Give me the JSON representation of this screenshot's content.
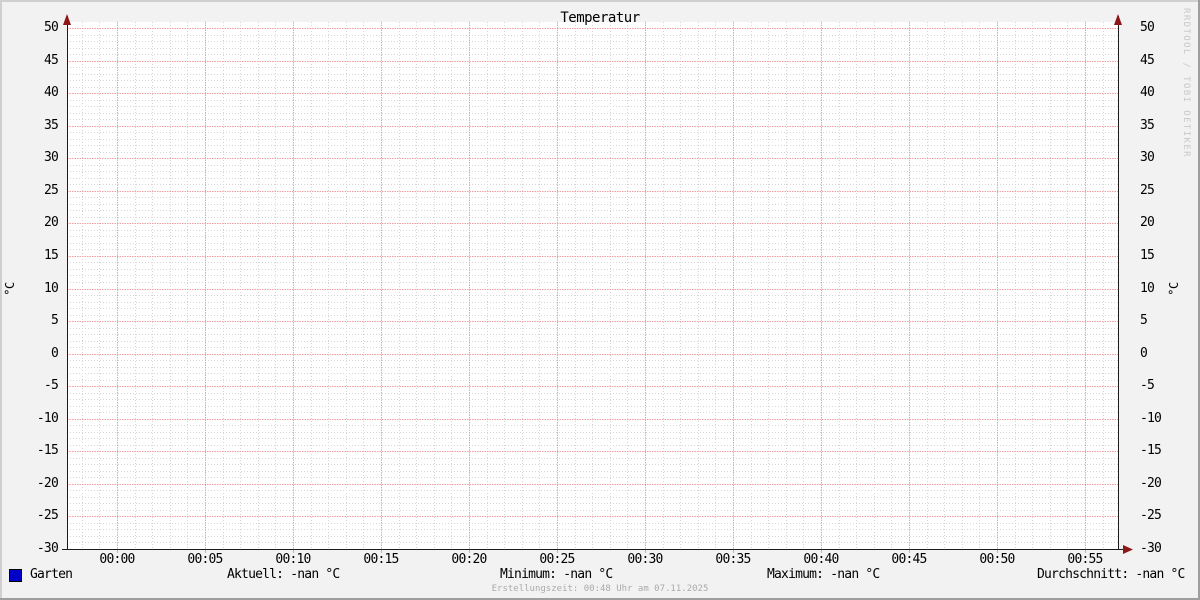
{
  "title": "Temperatur",
  "watermark": "RRDTOOL / TOBI OETIKER",
  "axis": {
    "y_label_left": "°C",
    "y_label_right": "°C",
    "y_ticks": [
      50,
      45,
      40,
      35,
      30,
      25,
      20,
      15,
      10,
      5,
      0,
      -5,
      -10,
      -15,
      -20,
      -25,
      -30
    ],
    "x_ticks": [
      "00:00",
      "00:05",
      "00:10",
      "00:15",
      "00:20",
      "00:25",
      "00:30",
      "00:35",
      "00:40",
      "00:45",
      "00:50",
      "00:55"
    ]
  },
  "legend": {
    "series_label": "Garten",
    "series_color": "#0000c8",
    "stats": [
      "Aktuell: -nan °C",
      "Minimum: -nan °C",
      "Maximum: -nan °C",
      "Durchschnitt: -nan °C"
    ],
    "footer": "Erstellungszeit: 00:48 Uhr am 07.11.2025"
  },
  "colors": {
    "back": "#f2f2f2",
    "canvas": "#ffffff",
    "major-grid": "#f0a0a0",
    "minor-grid": "#d6d6d6",
    "axis": "#1c1c1c",
    "arrow": "#8f1616",
    "faint": "#aaaaaa",
    "watermark": "#c8c8c8"
  },
  "chart_data": {
    "type": "line",
    "title": "Temperatur",
    "xlabel": "",
    "ylabel": "°C",
    "ylim": [
      -30,
      50
    ],
    "y_tick_step": 5,
    "y_minor_step": 1,
    "x_ticks": [
      "00:00",
      "00:05",
      "00:10",
      "00:15",
      "00:20",
      "00:25",
      "00:30",
      "00:35",
      "00:40",
      "00:45",
      "00:50",
      "00:55"
    ],
    "x_minor_ticks_per_interval": 5,
    "grid": true,
    "legend_position": "bottom",
    "series": [
      {
        "name": "Garten",
        "color": "#0000c8",
        "values": [],
        "current": "-nan °C",
        "min": "-nan °C",
        "max": "-nan °C",
        "avg": "-nan °C"
      }
    ]
  }
}
